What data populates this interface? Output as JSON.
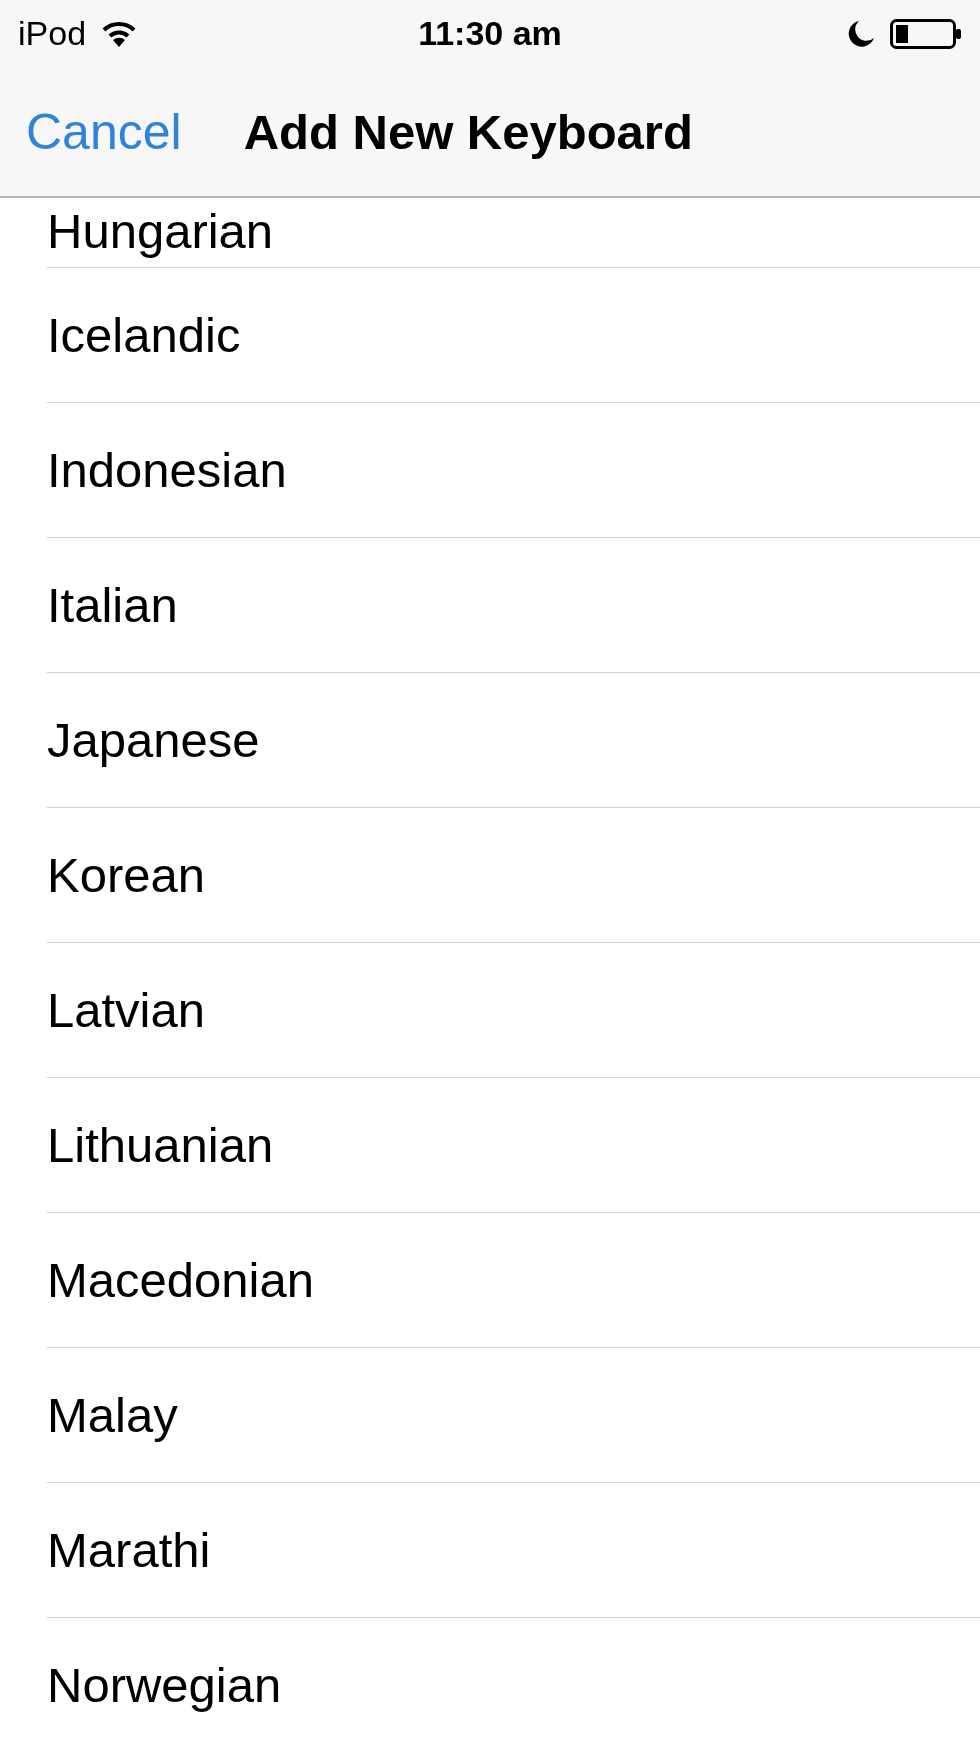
{
  "status_bar": {
    "carrier": "iPod",
    "time": "11:30 am"
  },
  "nav_bar": {
    "cancel": "Cancel",
    "title": "Add New Keyboard"
  },
  "languages": [
    "Hungarian",
    "Icelandic",
    "Indonesian",
    "Italian",
    "Japanese",
    "Korean",
    "Latvian",
    "Lithuanian",
    "Macedonian",
    "Malay",
    "Marathi",
    "Norwegian"
  ]
}
